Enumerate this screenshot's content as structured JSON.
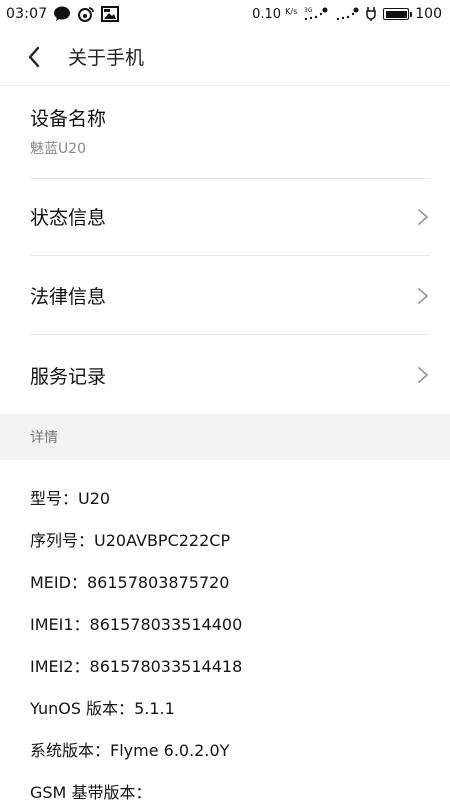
{
  "status_bar": {
    "time": "03:07",
    "network_speed": "0.10",
    "network_speed_unit": "K/s",
    "battery_percent": "100",
    "battery_level": 1.0,
    "icons": [
      "message-icon",
      "weibo-icon",
      "image-notification-icon",
      "3g-signal-icon",
      "signal-icon",
      "charging-icon",
      "battery-icon"
    ]
  },
  "header": {
    "title": "关于手机",
    "back_icon": "chevron-left-icon"
  },
  "device": {
    "label": "设备名称",
    "value": "魅蓝U20"
  },
  "menu": {
    "status_info": "状态信息",
    "legal_info": "法律信息",
    "service_records": "服务记录",
    "chevron_icon": "chevron-right-icon"
  },
  "details": {
    "header": "详情",
    "items": [
      {
        "key": "型号：",
        "value": "U20"
      },
      {
        "key": "序列号：",
        "value": "U20AVBPC222CP"
      },
      {
        "key": "MEID：",
        "value": "86157803875720"
      },
      {
        "key": "IMEI1：",
        "value": "861578033514400"
      },
      {
        "key": "IMEI2：",
        "value": "861578033514418"
      },
      {
        "key": "YunOS 版本：",
        "value": "5.1.1"
      },
      {
        "key": "系统版本：",
        "value": "Flyme 6.0.2.0Y"
      },
      {
        "key": "GSM 基带版本：",
        "value": ""
      }
    ]
  }
}
